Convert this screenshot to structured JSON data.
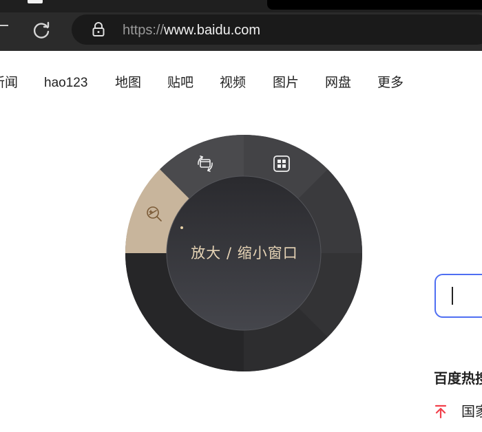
{
  "browser": {
    "url_scheme": "https://",
    "url_host": "www.baidu.com"
  },
  "nav": {
    "items": [
      "新闻",
      "hao123",
      "地图",
      "贴吧",
      "视频",
      "图片",
      "网盘",
      "更多"
    ]
  },
  "radial_menu": {
    "center_label": "放大 / 缩小窗口",
    "segments": [
      {
        "icon": "rotate-window-icon",
        "active": false
      },
      {
        "icon": "grid-layout-icon",
        "active": false
      },
      {
        "icon": "zoom-window-icon",
        "active": true
      }
    ],
    "colors": {
      "accent": "#c8b59c",
      "ring": "#3b3b3e",
      "center_top": "#2b2b2f",
      "center_bottom": "#45464c",
      "label": "#e7d4b6"
    }
  },
  "baidu": {
    "search_accent": "#4e6ef2",
    "hot_title": "百度热搜",
    "hot_first_item": "国家",
    "hot_arrow_color": "#f1404b"
  }
}
